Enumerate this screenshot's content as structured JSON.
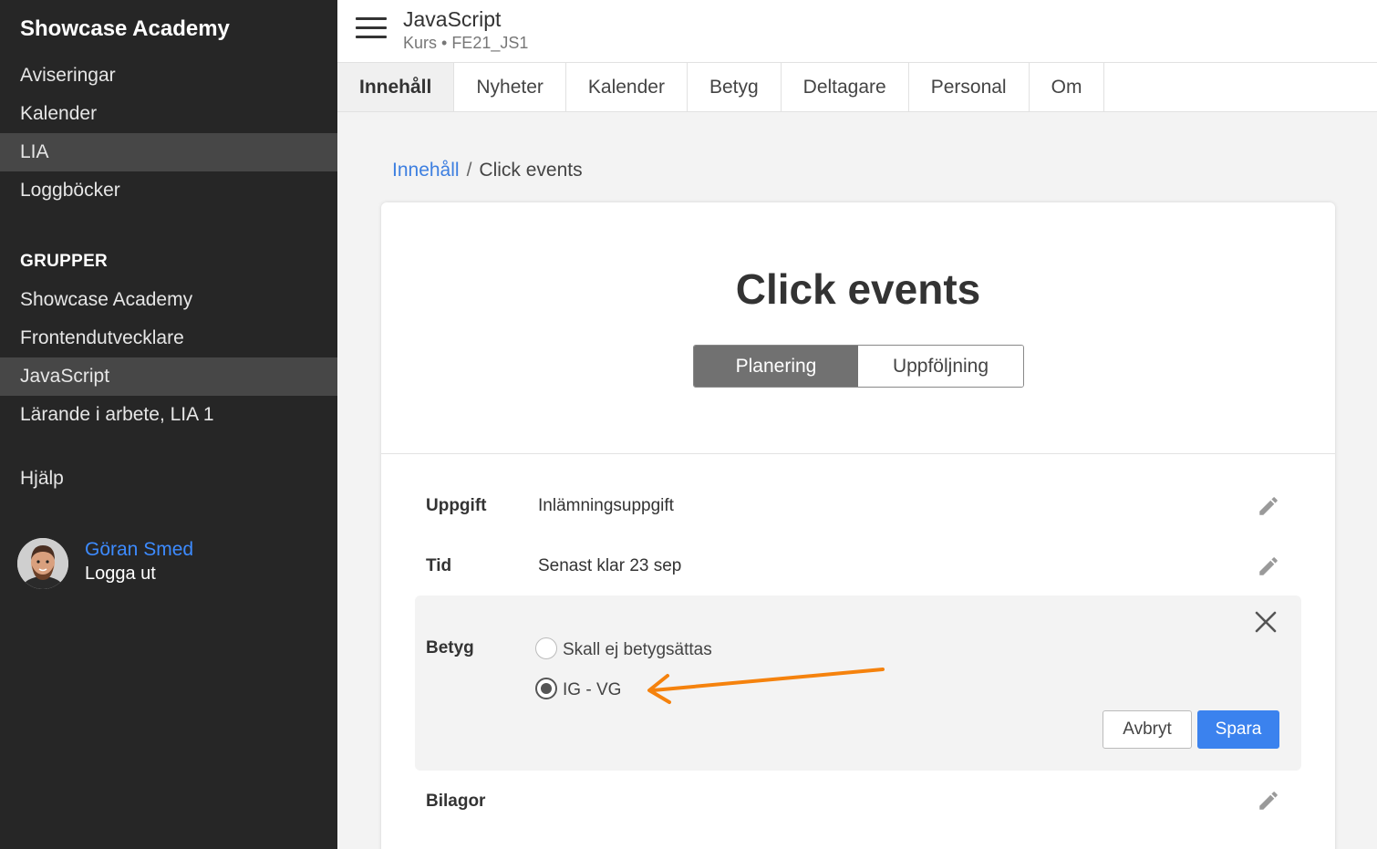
{
  "sidebar": {
    "brand": "Showcase Academy",
    "items": [
      {
        "label": "Aviseringar"
      },
      {
        "label": "Kalender"
      },
      {
        "label": "LIA"
      },
      {
        "label": "Loggböcker"
      }
    ],
    "groups_heading": "GRUPPER",
    "groups": [
      {
        "label": "Showcase Academy"
      },
      {
        "label": "Frontendutvecklare"
      },
      {
        "label": "JavaScript"
      },
      {
        "label": "Lärande i arbete, LIA 1"
      }
    ],
    "help": "Hjälp",
    "user": {
      "name": "Göran Smed",
      "logout": "Logga ut"
    }
  },
  "header": {
    "title": "JavaScript",
    "subtitle": "Kurs • FE21_JS1",
    "tabs": [
      {
        "label": "Innehåll"
      },
      {
        "label": "Nyheter"
      },
      {
        "label": "Kalender"
      },
      {
        "label": "Betyg"
      },
      {
        "label": "Deltagare"
      },
      {
        "label": "Personal"
      },
      {
        "label": "Om"
      }
    ]
  },
  "breadcrumb": {
    "parent": "Innehåll",
    "separator": "/",
    "current": "Click events"
  },
  "card": {
    "title": "Click events",
    "segments": [
      {
        "label": "Planering"
      },
      {
        "label": "Uppföljning"
      }
    ],
    "rows": {
      "uppgift": {
        "label": "Uppgift",
        "value": "Inlämningsuppgift"
      },
      "tid": {
        "label": "Tid",
        "value": "Senast klar 23 sep"
      },
      "betyg": {
        "label": "Betyg",
        "options": [
          {
            "label": "Skall ej betygsättas",
            "checked": false
          },
          {
            "label": "IG - VG",
            "checked": true
          }
        ],
        "cancel": "Avbryt",
        "save": "Spara"
      },
      "bilagor": {
        "label": "Bilagor"
      }
    }
  },
  "colors": {
    "accent": "#3b82ee",
    "link": "#3d8bff",
    "arrow": "#f5820d",
    "sidebar": "#262626"
  }
}
